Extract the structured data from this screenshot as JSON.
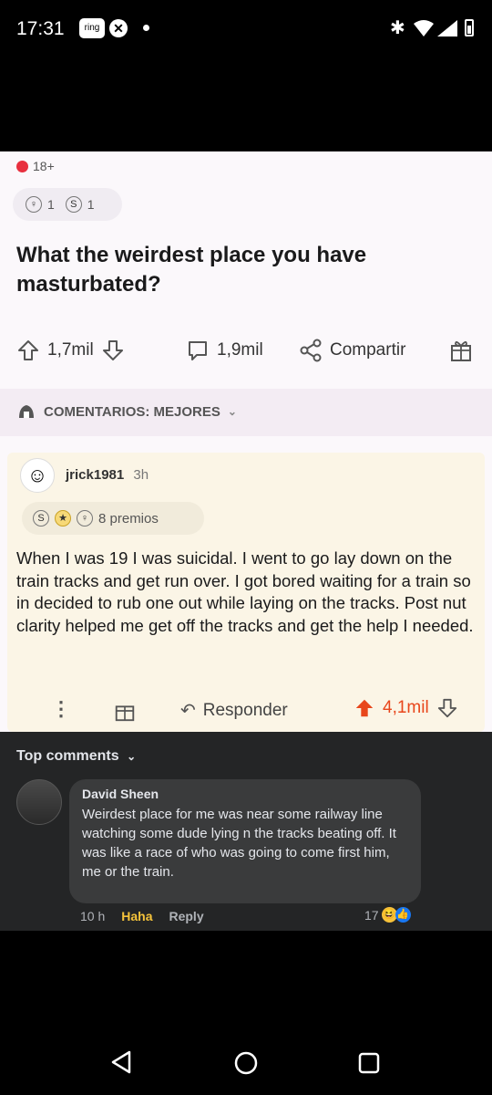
{
  "status_bar": {
    "time": "17:31",
    "ring_label": "ring"
  },
  "reddit": {
    "nsfw_tag": "18+",
    "post_awards": [
      {
        "icon": "helpful-award-icon",
        "count": "1"
      },
      {
        "icon": "silver-award-icon",
        "count": "1"
      }
    ],
    "title": "What the weirdest place you have masturbated?",
    "upvotes": "1,7mil",
    "comments_count": "1,9mil",
    "share_label": "Compartir",
    "sort_label": "COMENTARIOS: MEJORES",
    "top_comment": {
      "username": "jrick1981",
      "age": "3h",
      "awards_label": "8 premios",
      "body": "When I was 19 I was suicidal. I went to go lay down on the train tracks and get run over. I got bored waiting for a train so in decided to rub one out while laying on the tracks. Post nut clarity helped me get off the tracks and get the help I needed.",
      "reply_label": "Responder",
      "score": "4,1mil",
      "upvote_color": "#e8461b"
    }
  },
  "facebook": {
    "section_title": "Top comments",
    "comment": {
      "author": "David Sheen",
      "text": "Weirdest place for me was near some railway line watching some dude lying n the tracks beating off. It was like a race of who was going to come first him, me or the train.",
      "time": "10 h",
      "haha_label": "Haha",
      "reply_label": "Reply",
      "reaction_count": "17"
    }
  }
}
